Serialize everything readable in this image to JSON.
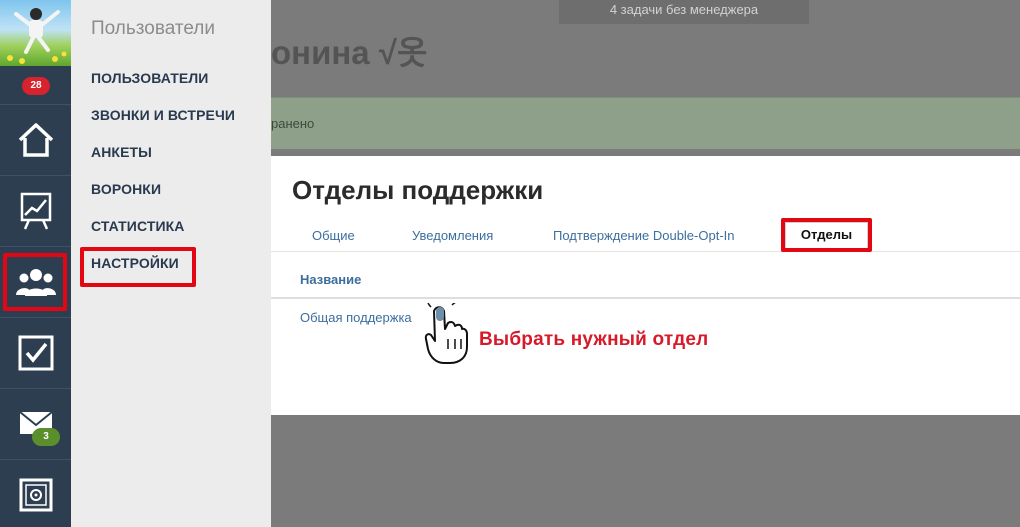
{
  "rail": {
    "notifications_badge": "28",
    "mail_badge": "3",
    "icons": [
      "home-icon",
      "chart-icon",
      "users-icon",
      "checkbox-icon",
      "mail-icon",
      "safe-icon"
    ]
  },
  "submenu": {
    "title": "Пользователи",
    "items": [
      {
        "label": "ПОЛЬЗОВАТЕЛИ"
      },
      {
        "label": "ЗВОНКИ И ВСТРЕЧИ"
      },
      {
        "label": "АНКЕТЫ"
      },
      {
        "label": "ВОРОНКИ"
      },
      {
        "label": "СТАТИСТИКА"
      },
      {
        "label": "НАСТРОЙКИ"
      }
    ]
  },
  "background": {
    "top_strip": "4 задачи без менеджера",
    "heading_fragment": "онина √옷",
    "success_fragment": "ранено"
  },
  "panel": {
    "title": "Отделы поддержки",
    "tabs": [
      {
        "label": "Общие"
      },
      {
        "label": "Уведомления"
      },
      {
        "label": "Подтверждение Double-Opt-In"
      },
      {
        "label": "Отделы"
      }
    ],
    "column_header": "Название",
    "rows": [
      {
        "label": "Общая поддержка"
      }
    ]
  },
  "annotation": {
    "callout": "Выбрать нужный отдел"
  },
  "colors": {
    "rail": "#2d3e50",
    "highlight": "#e30613",
    "link": "#3c6e9e",
    "callout": "#d7192a"
  }
}
